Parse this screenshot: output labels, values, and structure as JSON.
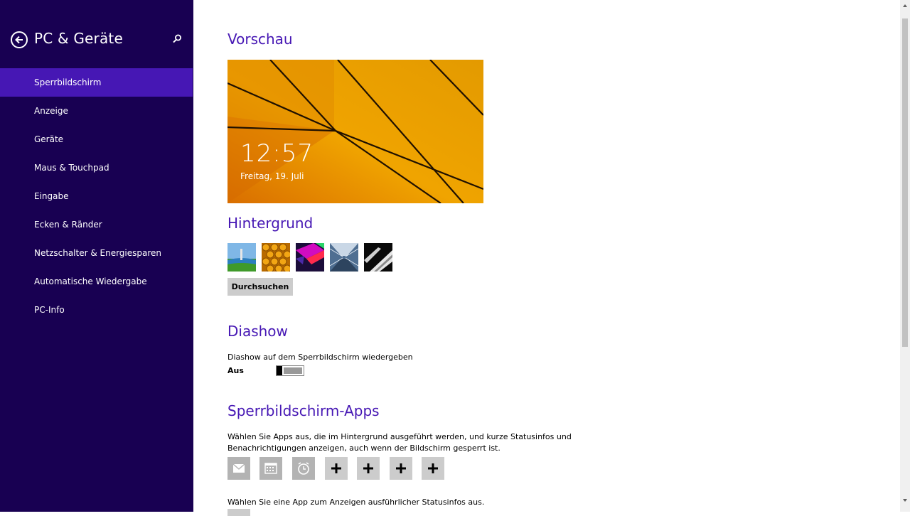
{
  "sidebar": {
    "title": "PC & Geräte",
    "items": [
      {
        "label": "Sperrbildschirm",
        "active": true
      },
      {
        "label": "Anzeige"
      },
      {
        "label": "Geräte"
      },
      {
        "label": "Maus & Touchpad"
      },
      {
        "label": "Eingabe"
      },
      {
        "label": "Ecken & Ränder"
      },
      {
        "label": "Netzschalter & Energiesparen"
      },
      {
        "label": "Automatische Wiedergabe"
      },
      {
        "label": "PC-Info"
      }
    ]
  },
  "preview": {
    "heading": "Vorschau",
    "time": "12:57",
    "date": "Freitag, 19. Juli"
  },
  "background": {
    "heading": "Hintergrund",
    "browse_label": "Durchsuchen"
  },
  "slideshow": {
    "heading": "Diashow",
    "description": "Diashow auf dem Sperrbildschirm wiedergeben",
    "state_label": "Aus"
  },
  "lock_apps": {
    "heading": "Sperrbildschirm-Apps",
    "description_line1": "Wählen Sie Apps aus, die im Hintergrund ausgeführt werden, und kurze Statusinfos und",
    "description_line2": "Benachrichtigungen anzeigen, auch wenn der Bildschirm gesperrt ist.",
    "detailed_description": "Wählen Sie eine App zum Anzeigen ausführlicher Statusinfos aus."
  },
  "colors": {
    "sidebar_bg": "#180052",
    "active_item": "#4617b4",
    "heading": "#4617b4"
  }
}
